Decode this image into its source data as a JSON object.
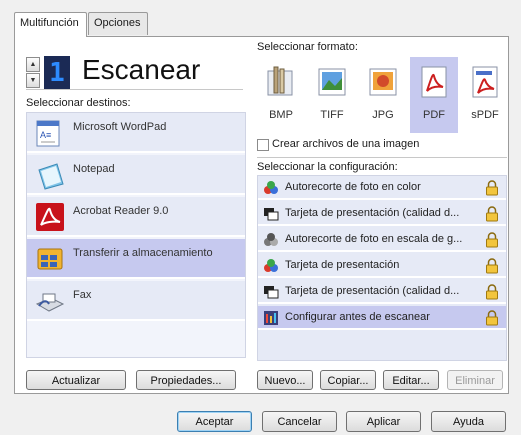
{
  "tabs": [
    "Multifunción",
    "Opciones"
  ],
  "scan": {
    "counter": "1",
    "label": "Escanear"
  },
  "destinations": {
    "title": "Seleccionar destinos:",
    "items": [
      {
        "label": "Microsoft WordPad",
        "icon": "wordpad-icon",
        "selected": false
      },
      {
        "label": "Notepad",
        "icon": "notepad-icon",
        "selected": false
      },
      {
        "label": "Acrobat Reader 9.0",
        "icon": "acrobat-icon",
        "selected": false
      },
      {
        "label": "Transferir a almacenamiento",
        "icon": "storage-icon",
        "selected": true
      },
      {
        "label": "Fax",
        "icon": "fax-icon",
        "selected": false
      }
    ]
  },
  "formats": {
    "title": "Seleccionar formato:",
    "items": [
      {
        "label": "BMP",
        "icon": "bmp-icon",
        "selected": false
      },
      {
        "label": "TIFF",
        "icon": "tiff-icon",
        "selected": false
      },
      {
        "label": "JPG",
        "icon": "jpg-icon",
        "selected": false
      },
      {
        "label": "PDF",
        "icon": "pdf-icon",
        "selected": true
      },
      {
        "label": "sPDF",
        "icon": "spdf-icon",
        "selected": false
      }
    ],
    "single_image_label": "Crear archivos de una imagen"
  },
  "configs": {
    "title": "Seleccionar la configuración:",
    "items": [
      {
        "label": "Autorecorte de foto en color",
        "icon": "color-photo-icon",
        "selected": false
      },
      {
        "label": "Tarjeta de presentación (calidad d...",
        "icon": "business-card-bw-icon",
        "selected": false
      },
      {
        "label": "Autorecorte de foto en escala de g...",
        "icon": "grayscale-photo-icon",
        "selected": false
      },
      {
        "label": "Tarjeta de presentación",
        "icon": "color-photo-icon",
        "selected": false
      },
      {
        "label": "Tarjeta de presentación (calidad d...",
        "icon": "business-card-bw-icon",
        "selected": false
      },
      {
        "label": "Configurar antes de escanear",
        "icon": "configure-icon",
        "selected": true
      }
    ]
  },
  "buttons": {
    "refresh": "Actualizar",
    "properties": "Propiedades...",
    "new": "Nuevo...",
    "copy": "Copiar...",
    "edit": "Editar...",
    "delete": "Eliminar",
    "ok": "Aceptar",
    "cancel": "Cancelar",
    "apply": "Aplicar",
    "help": "Ayuda"
  },
  "colors": {
    "selection": "#c6c9ef",
    "list_bg": "#e6eaf6",
    "counter_bg": "#1b2a55",
    "counter_fg": "#2d8bff"
  }
}
